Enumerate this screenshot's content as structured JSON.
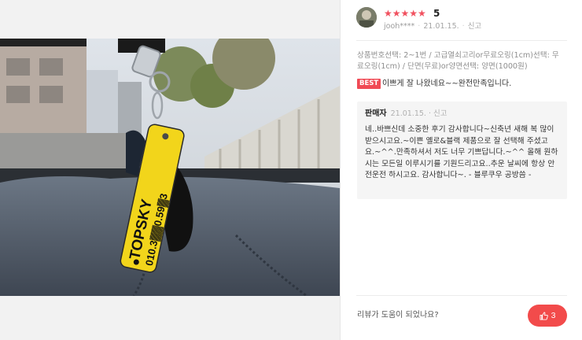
{
  "review": {
    "rating_stars": "★★★★★",
    "rating_value": "5",
    "user": "jooh****",
    "date": "21.01.15.",
    "report_label": "신고",
    "options": "상품번호선택: 2~1번 / 고급열쇠고리or무료오링(1cm)선택: 무료오링(1cm) / 단면(무료)or양면선택: 양면(1000원)",
    "best_badge": "BEST",
    "text": "이쁘게 잘 나왔네요~~완전만족입니다."
  },
  "photo": {
    "tag_line1": "TOPSKY",
    "tag_line2": "010.3▓▓0.59▓3"
  },
  "seller_reply": {
    "name": "판매자",
    "date": "21.01.15.",
    "report_label": "신고",
    "text": "네..바쁘신데 소중한 후기 감사합니다~신축년 새해 복 많이 받으시고요.~이쁜 옐로&블랙 제품으로 잘 선택해 주셨고요.~^^.만족하셔서 저도 너무 기쁘답니다.~^^ 올해 원하시는 모든일 이루시기를 기원드리고요..추운 날씨에 항상 안전운전 하시고요. 감사합니다~. - 블루쿠우 공방씀 -"
  },
  "helpful": {
    "question": "리뷰가 도움이 되었나요?",
    "count": "3"
  },
  "colors": {
    "accent": "#f24b4b",
    "star": "#f1515f",
    "tag_yellow": "#f2d51b"
  }
}
